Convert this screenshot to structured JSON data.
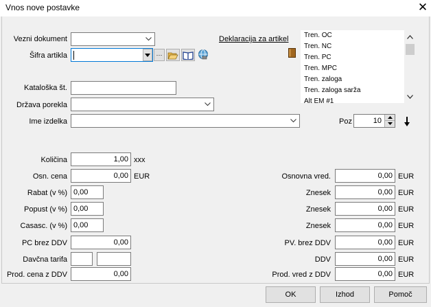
{
  "window": {
    "title": "Vnos nove postavke",
    "close_glyph": "✕"
  },
  "header": {
    "vezni_dokument_label": "Vezni dokument",
    "vezni_dokument_value": "",
    "deklaracija_link": "Deklaracija za artikel",
    "sifra_label": "Šifra artikla",
    "sifra_value": "",
    "ellipsis": "···"
  },
  "tren_list": {
    "items": [
      "Tren. OC",
      "Tren. NC",
      "Tren. PC",
      "Tren. MPC",
      "Tren. zaloga",
      "Tren. zaloga sarža",
      "Alt EM #1"
    ]
  },
  "fields": {
    "kataloska_label": "Kataloška št.",
    "kataloska_value": "",
    "drzava_label": "Država porekla",
    "drzava_value": "",
    "ime_label": "Ime izdelka",
    "ime_value": "",
    "poz_label": "Poz",
    "poz_value": "10"
  },
  "left_form": {
    "kolicina_label": "Količina",
    "kolicina_value": "1,00",
    "kolicina_unit": "xxx",
    "osn_cena_label": "Osn. cena",
    "osn_cena_value": "0,00",
    "osn_cena_unit": "EUR",
    "rabat_label": "Rabat (v %)",
    "rabat_value": "0,00",
    "popust_label": "Popust (v %)",
    "popust_value": "0,00",
    "casasc_label": "Casasc. (v %)",
    "casasc_value": "0,00",
    "pc_brez_label": "PC brez DDV",
    "pc_brez_value": "0,00",
    "davcna_label": "Davčna tarifa",
    "davcna_code": "",
    "davcna_desc": "",
    "prod_cena_label": "Prod. cena z DDV",
    "prod_cena_value": "0,00"
  },
  "right_form": {
    "osnovna_label": "Osnovna vred.",
    "osnovna_value": "0,00",
    "znesek1_label": "Znesek",
    "znesek1_value": "0,00",
    "znesek2_label": "Znesek",
    "znesek2_value": "0,00",
    "znesek3_label": "Znesek",
    "znesek3_value": "0,00",
    "pv_brez_label": "PV. brez DDV",
    "pv_brez_value": "0,00",
    "ddv_label": "DDV",
    "ddv_value": "0,00",
    "prod_vred_label": "Prod. vred z DDV",
    "prod_vred_value": "0,00",
    "currency": "EUR"
  },
  "buttons": {
    "ok": "OK",
    "izhod": "Izhod",
    "pomoc": "Pomoč"
  }
}
